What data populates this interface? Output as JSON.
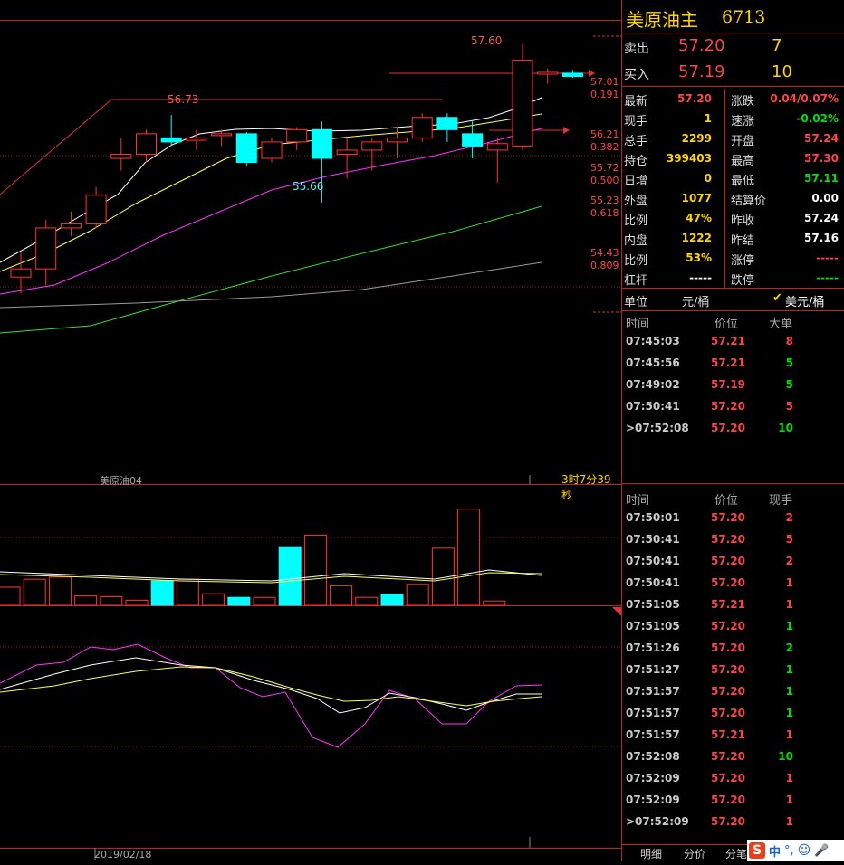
{
  "chart": {
    "contract_label": "美原油04",
    "countdown": "3时7分39秒",
    "date_label": "2019/02/18",
    "high_label": "57.60",
    "peak_label": "56.73",
    "low_label": "55.66",
    "fib_levels": [
      {
        "price": "57.01",
        "ratio": "0.191"
      },
      {
        "price": "56.21",
        "ratio": "0.382"
      },
      {
        "price": "55.72",
        "ratio": "0.500"
      },
      {
        "price": "55.23",
        "ratio": "0.618"
      },
      {
        "price": "54.43",
        "ratio": "0.809"
      }
    ],
    "candles": [
      {
        "o": 54.75,
        "h": 55.05,
        "l": 54.55,
        "c": 54.85,
        "bull": true
      },
      {
        "o": 54.85,
        "h": 55.45,
        "l": 54.65,
        "c": 55.35,
        "bull": true
      },
      {
        "o": 55.35,
        "h": 55.55,
        "l": 55.25,
        "c": 55.4,
        "bull": true
      },
      {
        "o": 55.4,
        "h": 55.85,
        "l": 55.35,
        "c": 55.75,
        "bull": true
      },
      {
        "o": 56.2,
        "h": 56.45,
        "l": 56.05,
        "c": 56.25,
        "bull": true
      },
      {
        "o": 56.25,
        "h": 56.55,
        "l": 56.15,
        "c": 56.5,
        "bull": true
      },
      {
        "o": 56.45,
        "h": 56.73,
        "l": 56.35,
        "c": 56.4,
        "bull": false
      },
      {
        "o": 56.42,
        "h": 56.55,
        "l": 56.3,
        "c": 56.45,
        "bull": true
      },
      {
        "o": 56.48,
        "h": 56.55,
        "l": 56.35,
        "c": 56.5,
        "bull": true
      },
      {
        "o": 56.5,
        "h": 56.52,
        "l": 56.1,
        "c": 56.15,
        "bull": false
      },
      {
        "o": 56.2,
        "h": 56.45,
        "l": 56.15,
        "c": 56.4,
        "bull": true
      },
      {
        "o": 56.4,
        "h": 56.58,
        "l": 56.3,
        "c": 56.55,
        "bull": true
      },
      {
        "o": 56.55,
        "h": 56.65,
        "l": 55.66,
        "c": 56.2,
        "bull": false
      },
      {
        "o": 56.25,
        "h": 56.45,
        "l": 55.95,
        "c": 56.3,
        "bull": true
      },
      {
        "o": 56.3,
        "h": 56.45,
        "l": 56.05,
        "c": 56.4,
        "bull": true
      },
      {
        "o": 56.4,
        "h": 56.58,
        "l": 56.2,
        "c": 56.45,
        "bull": true
      },
      {
        "o": 56.45,
        "h": 56.75,
        "l": 56.4,
        "c": 56.7,
        "bull": true
      },
      {
        "o": 56.7,
        "h": 56.75,
        "l": 56.4,
        "c": 56.55,
        "bull": false
      },
      {
        "o": 56.5,
        "h": 56.65,
        "l": 56.2,
        "c": 56.35,
        "bull": false
      },
      {
        "o": 56.3,
        "h": 56.45,
        "l": 55.9,
        "c": 56.38,
        "bull": true
      },
      {
        "o": 56.35,
        "h": 57.6,
        "l": 56.3,
        "c": 57.4,
        "bull": true
      },
      {
        "o": 57.25,
        "h": 57.3,
        "l": 57.11,
        "c": 57.25,
        "bull": true
      },
      {
        "o": 57.24,
        "h": 57.28,
        "l": 57.18,
        "c": 57.2,
        "bull": false
      }
    ],
    "volumes": [
      0.25,
      0.36,
      0.39,
      0.13,
      0.12,
      0.07,
      0.34,
      0.36,
      0.16,
      0.11,
      0.11,
      0.81,
      0.97,
      0.27,
      0.11,
      0.15,
      0.29,
      0.79,
      1.33,
      0.06
    ]
  },
  "quote": {
    "name": "美原油主",
    "code": "6713",
    "sell_label": "卖出",
    "sell_price": "57.20",
    "sell_vol": "7",
    "buy_label": "买入",
    "buy_price": "57.19",
    "buy_vol": "10"
  },
  "stats": [
    {
      "l1": "最新",
      "v1": "57.20",
      "c1": "r",
      "l2": "涨跌",
      "v2": "0.04/0.07%",
      "c2": "r"
    },
    {
      "l1": "现手",
      "v1": "1",
      "c1": "y",
      "l2": "速涨",
      "v2": "-0.02%",
      "c2": "g"
    },
    {
      "l1": "总手",
      "v1": "2299",
      "c1": "y",
      "l2": "开盘",
      "v2": "57.24",
      "c2": "r"
    },
    {
      "l1": "持仓",
      "v1": "399403",
      "c1": "y",
      "l2": "最高",
      "v2": "57.30",
      "c2": "r"
    },
    {
      "l1": "日增",
      "v1": "0",
      "c1": "y",
      "l2": "最低",
      "v2": "57.11",
      "c2": "g"
    },
    {
      "l1": "外盘",
      "v1": "1077",
      "c1": "y",
      "l2": "结算价",
      "v2": "0.00",
      "c2": "w"
    },
    {
      "l1": "比例",
      "v1": "47%",
      "c1": "y",
      "l2": "昨收",
      "v2": "57.24",
      "c2": "w"
    },
    {
      "l1": "内盘",
      "v1": "1222",
      "c1": "y",
      "l2": "昨结",
      "v2": "57.16",
      "c2": "w"
    },
    {
      "l1": "比例",
      "v1": "53%",
      "c1": "y",
      "l2": "涨停",
      "v2": "-----",
      "c2": "r"
    },
    {
      "l1": "杠杆",
      "v1": "-----",
      "c1": "w",
      "l2": "跌停",
      "v2": "-----",
      "c2": "g"
    }
  ],
  "unit": {
    "label": "单位",
    "value": "元/桶",
    "checked": "美元/桶"
  },
  "bigorders": {
    "headers": [
      "时间",
      "价位",
      "大单"
    ],
    "rows": [
      {
        "t": "07:45:03",
        "p": "57.21",
        "q": "8",
        "qc": "r"
      },
      {
        "t": "07:45:56",
        "p": "57.21",
        "q": "5",
        "qc": "g"
      },
      {
        "t": "07:49:02",
        "p": "57.19",
        "q": "5",
        "qc": "g"
      },
      {
        "t": "07:50:41",
        "p": "57.20",
        "q": "5",
        "qc": "r"
      },
      {
        "t": ">07:52:08",
        "p": "57.20",
        "q": "10",
        "qc": "g"
      }
    ]
  },
  "ticks": {
    "headers": [
      "时间",
      "价位",
      "现手"
    ],
    "rows": [
      {
        "t": "07:50:01",
        "p": "57.20",
        "q": "2",
        "qc": "r"
      },
      {
        "t": "07:50:41",
        "p": "57.20",
        "q": "5",
        "qc": "r"
      },
      {
        "t": "07:50:41",
        "p": "57.20",
        "q": "2",
        "qc": "r"
      },
      {
        "t": "07:50:41",
        "p": "57.20",
        "q": "1",
        "qc": "r"
      },
      {
        "t": "07:51:05",
        "p": "57.21",
        "q": "1",
        "qc": "r"
      },
      {
        "t": "07:51:05",
        "p": "57.20",
        "q": "1",
        "qc": "g"
      },
      {
        "t": "07:51:26",
        "p": "57.20",
        "q": "2",
        "qc": "g"
      },
      {
        "t": "07:51:27",
        "p": "57.20",
        "q": "1",
        "qc": "g"
      },
      {
        "t": "07:51:57",
        "p": "57.20",
        "q": "1",
        "qc": "g"
      },
      {
        "t": "07:51:57",
        "p": "57.20",
        "q": "1",
        "qc": "g"
      },
      {
        "t": "07:51:57",
        "p": "57.21",
        "q": "1",
        "qc": "r"
      },
      {
        "t": "07:52:08",
        "p": "57.20",
        "q": "10",
        "qc": "g"
      },
      {
        "t": "07:52:09",
        "p": "57.20",
        "q": "1",
        "qc": "r"
      },
      {
        "t": "07:52:09",
        "p": "57.20",
        "q": "1",
        "qc": "r"
      },
      {
        "t": ">07:52:09",
        "p": "57.20",
        "q": "1",
        "qc": "r"
      }
    ]
  },
  "tabs": [
    "明细",
    "分价",
    "分笔"
  ],
  "ime": "中"
}
